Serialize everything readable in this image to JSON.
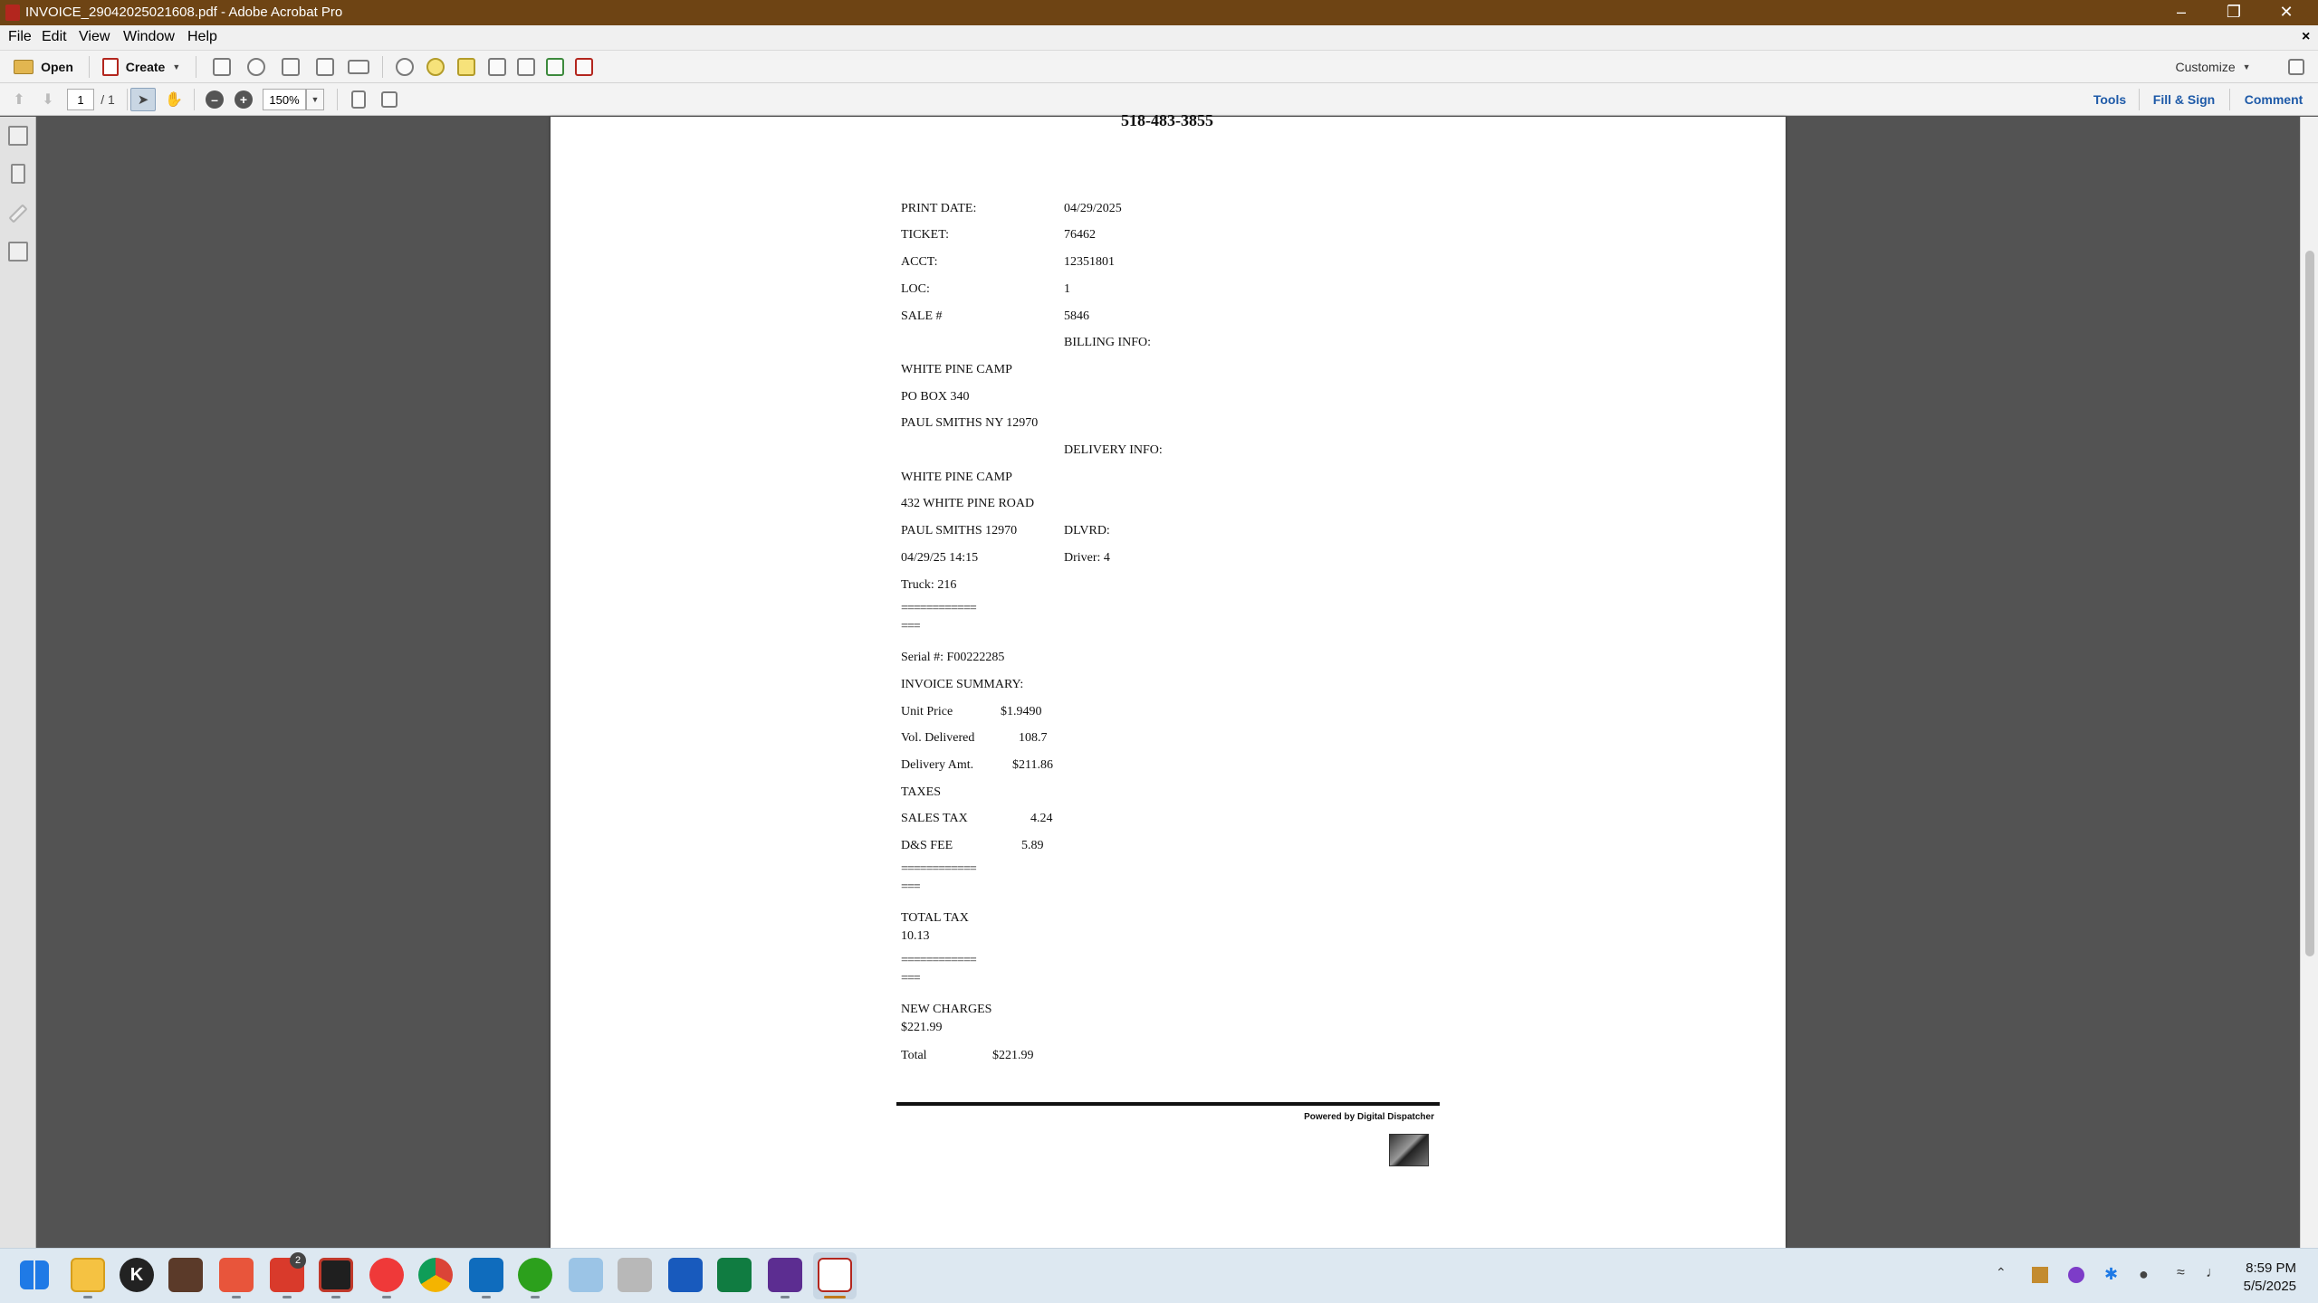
{
  "window": {
    "title": "INVOICE_29042025021608.pdf - Adobe Acrobat Pro",
    "close_doc": "×"
  },
  "menu": [
    "File",
    "Edit",
    "View",
    "Window",
    "Help"
  ],
  "toolbar": {
    "open": "Open",
    "create": "Create",
    "customize": "Customize"
  },
  "nav": {
    "page_current": "1",
    "page_total": "/ 1",
    "zoom": "150%"
  },
  "right_tools": {
    "tools": "Tools",
    "fill_sign": "Fill & Sign",
    "comment": "Comment"
  },
  "document": {
    "phone": "518-483-3855",
    "print_date_label": "PRINT DATE:",
    "print_date": "04/29/2025",
    "ticket_label": "TICKET:",
    "ticket": "76462",
    "acct_label": "ACCT:",
    "acct": "12351801",
    "loc_label": "LOC:",
    "loc": "1",
    "sale_label": "SALE #",
    "sale": "5846",
    "billing_heading": "BILLING INFO:",
    "billing_name": "WHITE PINE CAMP",
    "billing_addr": "PO BOX 340",
    "billing_city": "PAUL SMITHS  NY 12970",
    "delivery_heading": "DELIVERY INFO:",
    "delivery_name": "WHITE PINE CAMP",
    "delivery_addr": "432 WHITE PINE ROAD",
    "delivery_city": "PAUL SMITHS 12970",
    "dlvrd_label": "DLVRD:",
    "datetime": "04/29/25 14:15",
    "driver": "Driver: 4",
    "truck": "Truck: 216",
    "rule_long": "============",
    "rule_short": "===",
    "serial": "Serial #: F00222285",
    "summary_heading": "INVOICE SUMMARY:",
    "unit_price_label": "Unit Price",
    "unit_price": "$1.9490",
    "vol_label": "Vol. Delivered",
    "vol": "108.7",
    "delivery_amt_label": "Delivery Amt.",
    "delivery_amt": "$211.86",
    "taxes_heading": "TAXES",
    "sales_tax_label": "SALES TAX",
    "sales_tax": "4.24",
    "ds_fee_label": "D&S FEE",
    "ds_fee": "5.89",
    "total_tax_label": "TOTAL TAX",
    "total_tax": "10.13",
    "new_charges_label": "NEW CHARGES",
    "new_charges": "$221.99",
    "total_label": "Total",
    "total": "$221.99",
    "powered": "Powered by Digital Dispatcher"
  },
  "taskbar": {
    "time": "8:59 PM",
    "date": "5/5/2025",
    "badge": "2"
  },
  "colors": {
    "titlebar": "#6e4414",
    "accent": "#1e5aa8",
    "taskbar": "#dde8f1"
  }
}
